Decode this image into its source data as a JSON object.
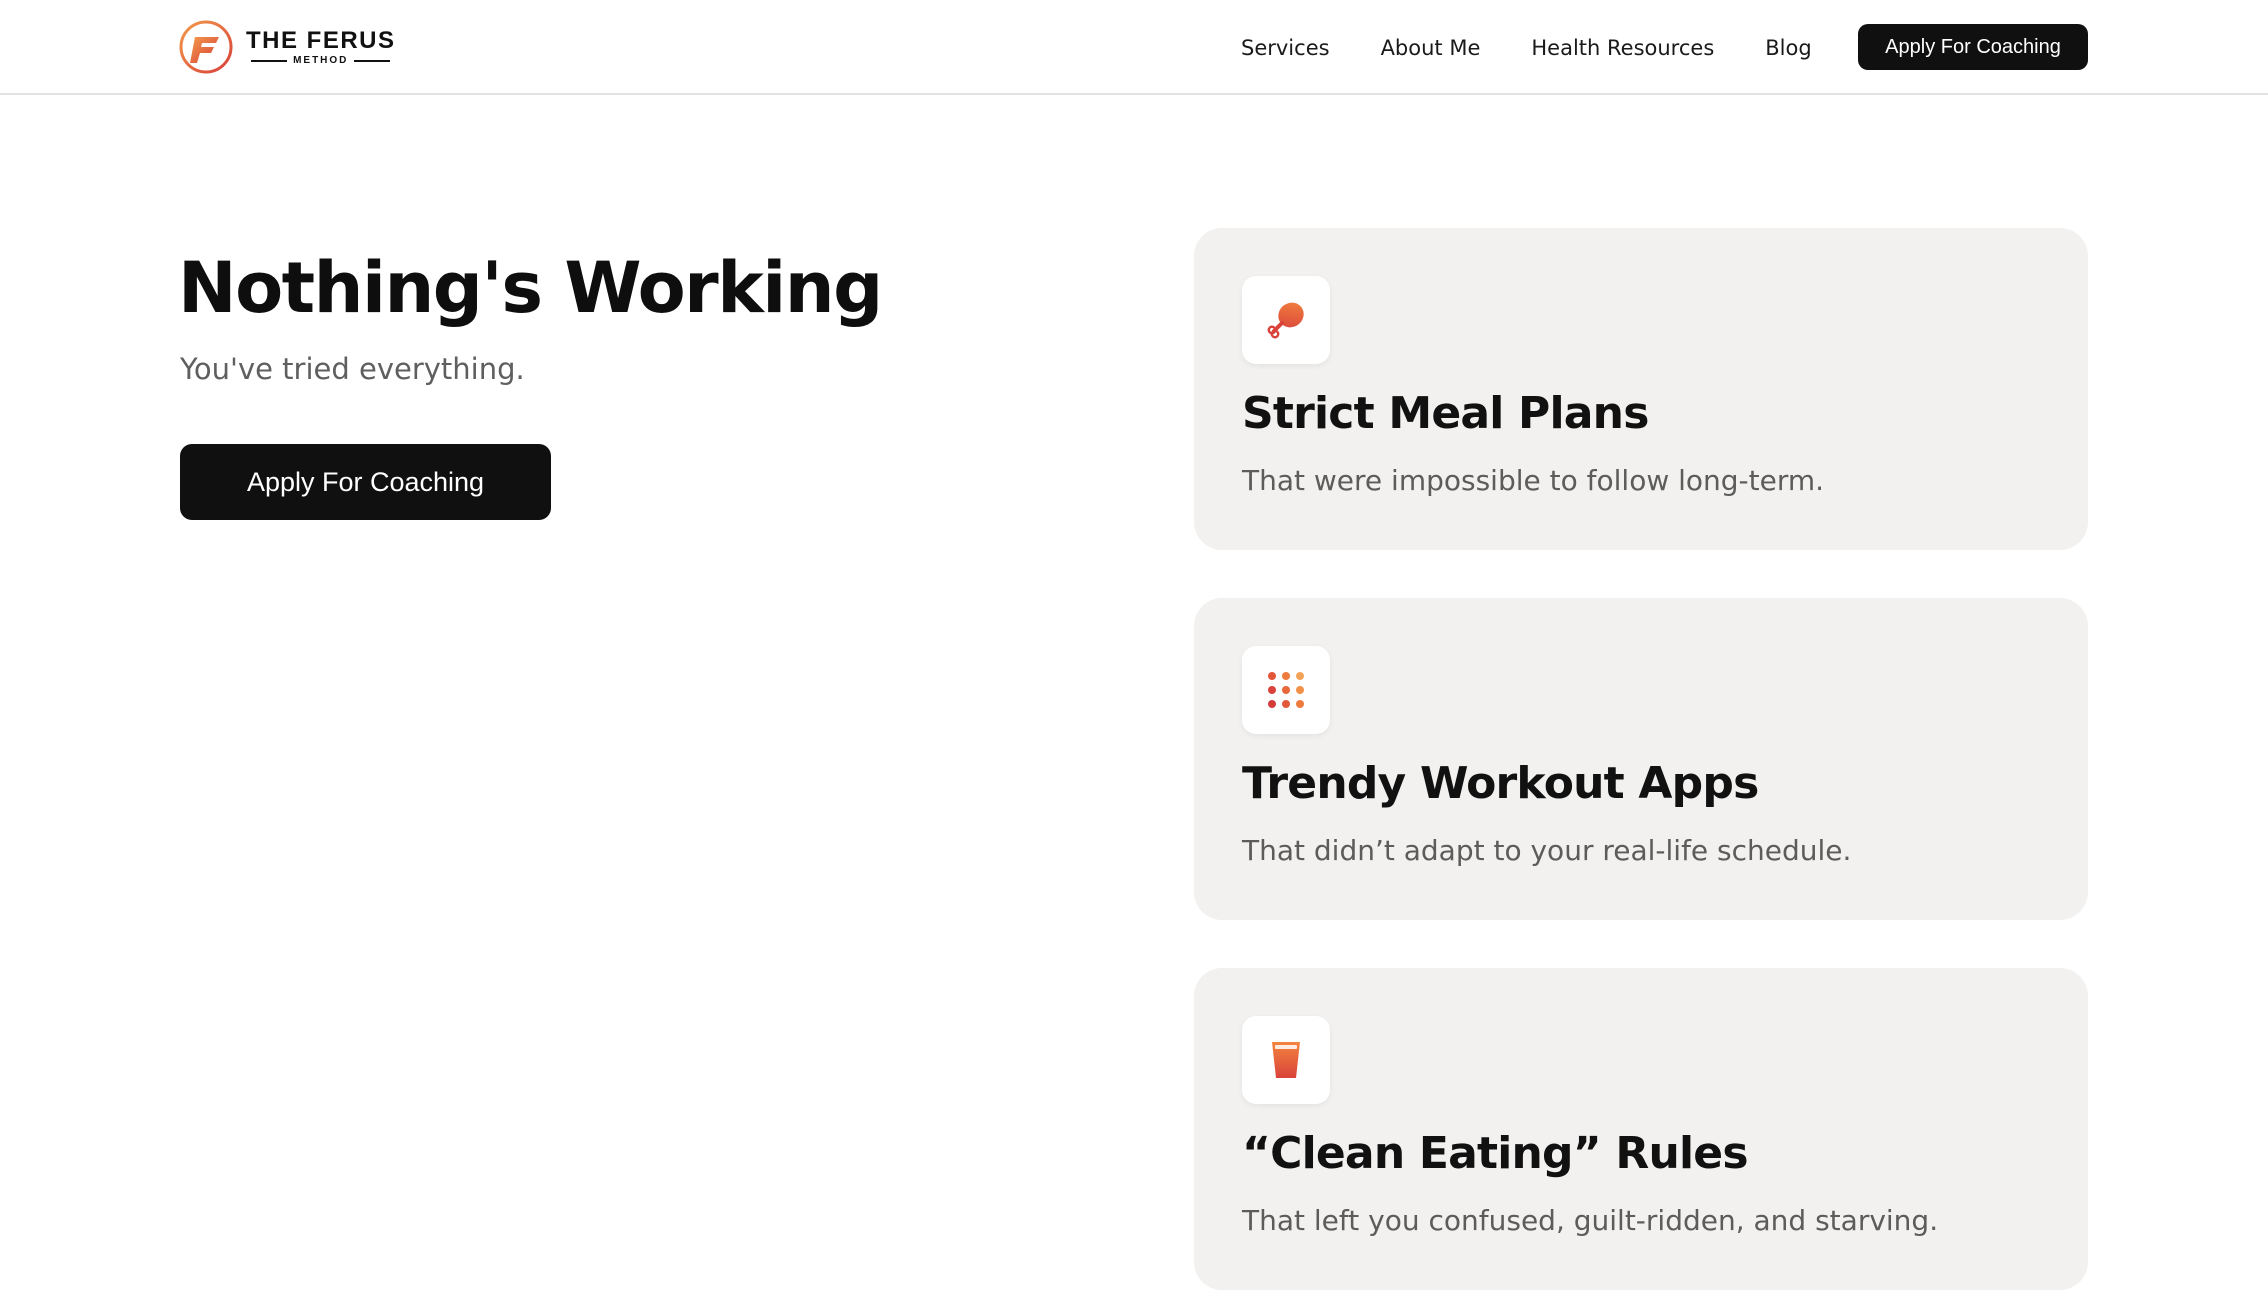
{
  "header": {
    "logo_title": "THE FERUS",
    "logo_sub": "METHOD",
    "nav": [
      {
        "label": "Services"
      },
      {
        "label": "About Me"
      },
      {
        "label": "Health Resources"
      },
      {
        "label": "Blog"
      }
    ],
    "cta_label": "Apply For Coaching"
  },
  "hero": {
    "title": "Nothing's Working",
    "subtitle": "You've tried everything.",
    "cta_label": "Apply For Coaching"
  },
  "cards": [
    {
      "icon": "drumstick-icon",
      "title": "Strict Meal Plans",
      "desc": "That were impossible to follow long-term."
    },
    {
      "icon": "dot-grid-icon",
      "title": "Trendy Workout Apps",
      "desc": "That didn’t adapt to your real-life schedule."
    },
    {
      "icon": "glass-icon",
      "title": "“Clean Eating” Rules",
      "desc": "That left you confused, guilt-ridden, and starving."
    }
  ],
  "colors": {
    "accent_orange": "#ee6a2c",
    "accent_red": "#d9433b",
    "card_bg": "#f2f1ef",
    "button_bg": "#111010"
  }
}
